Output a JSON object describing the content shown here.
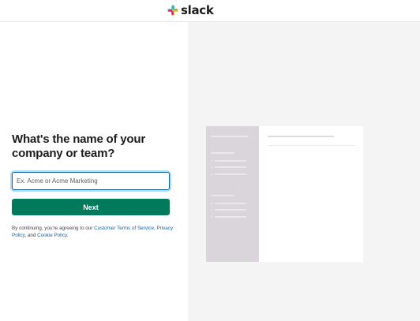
{
  "header": {
    "logo_text": "slack",
    "logo_icon": "slack-logo-icon"
  },
  "form": {
    "heading": "What's the name of your company or team?",
    "name_input": {
      "value": "",
      "placeholder": "Ex. Acme or Acme Marketing"
    },
    "next_label": "Next"
  },
  "legal": {
    "prefix": "By continuing, you're agreeing to our ",
    "terms_link": "Customer Terms of Service",
    "sep1": ", ",
    "privacy_link": "Privacy Policy",
    "sep2": ", and ",
    "cookie_link": "Cookie Policy",
    "suffix": "."
  },
  "colors": {
    "primary_button": "#007a5a",
    "link": "#1264a3",
    "input_focus": "#1264a3",
    "preview_sidebar": "#d9d5da",
    "right_panel_bg": "#f4f4f4",
    "logo_blue": "#36c5f0",
    "logo_green": "#2eb67d",
    "logo_yellow": "#ecb22e",
    "logo_red": "#e01e5a"
  }
}
